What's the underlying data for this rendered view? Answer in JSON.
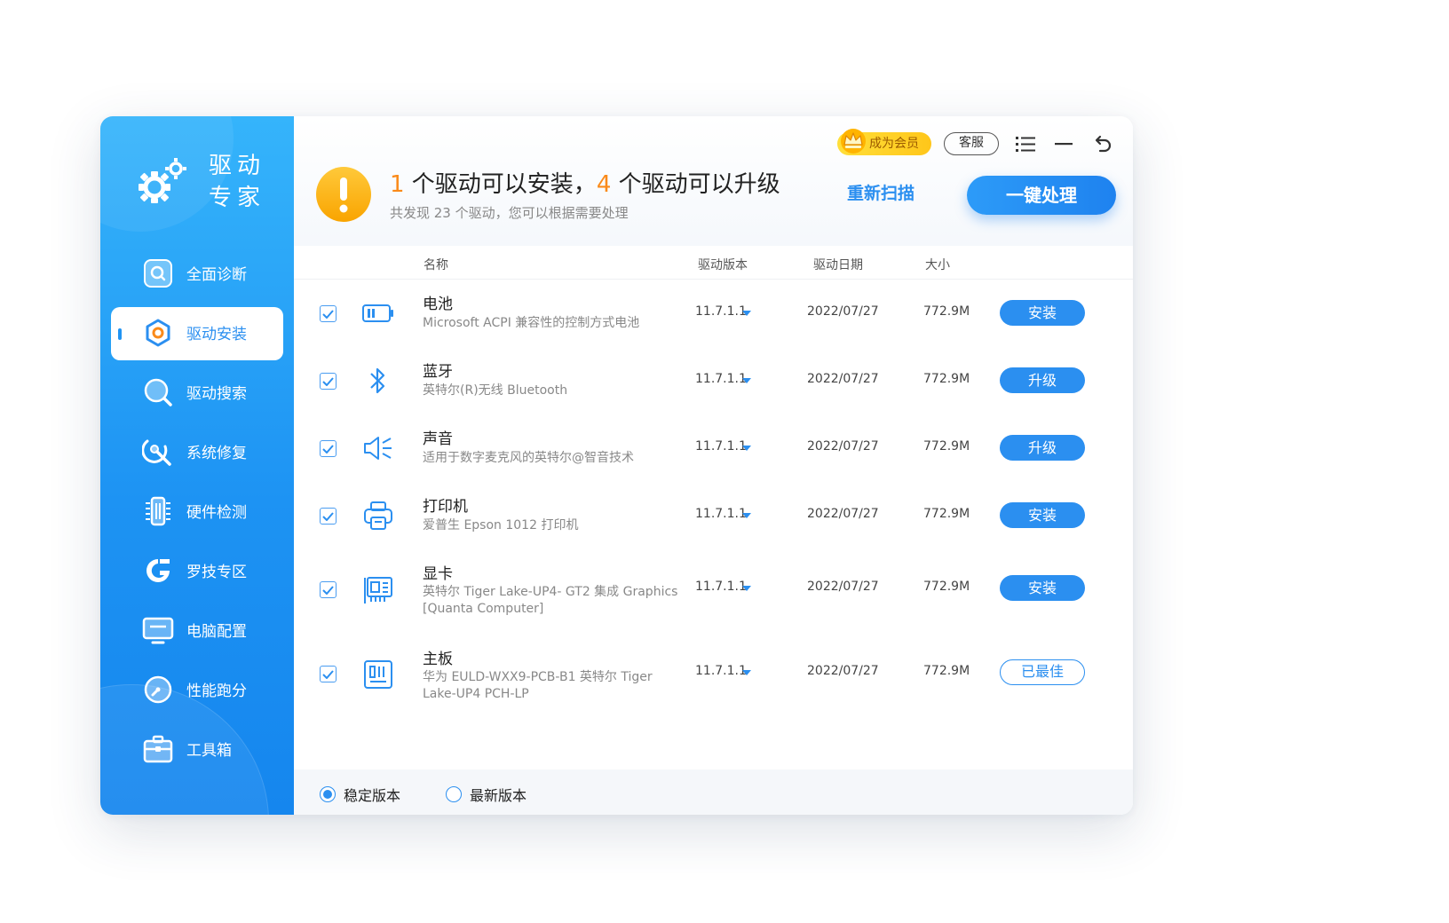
{
  "app": {
    "name_line1": "驱动",
    "name_line2": "专家"
  },
  "sidebar": {
    "items": [
      {
        "label": "全面诊断",
        "icon": "diagnose-icon"
      },
      {
        "label": "驱动安装",
        "icon": "install-icon",
        "active": true
      },
      {
        "label": "驱动搜索",
        "icon": "search-icon"
      },
      {
        "label": "系统修复",
        "icon": "repair-icon"
      },
      {
        "label": "硬件检测",
        "icon": "hardware-icon"
      },
      {
        "label": "罗技专区",
        "icon": "logitech-icon"
      },
      {
        "label": "电脑配置",
        "icon": "monitor-icon"
      },
      {
        "label": "性能跑分",
        "icon": "speedometer-icon"
      },
      {
        "label": "工具箱",
        "icon": "toolbox-icon"
      }
    ]
  },
  "topbar": {
    "vip_label": "成为会员",
    "service_label": "客服"
  },
  "summary": {
    "install_count": "1",
    "install_text": " 个驱动可以安装，",
    "upgrade_count": "4",
    "upgrade_text": " 个驱动可以升级",
    "subline": "共发现 23 个驱动，您可以根据需要处理",
    "rescan_label": "重新扫描",
    "onekey_label": "一键处理"
  },
  "table": {
    "headers": {
      "name": "名称",
      "version": "驱动版本",
      "date": "驱动日期",
      "size": "大小"
    },
    "rows": [
      {
        "name": "电池",
        "desc": "Microsoft ACPI 兼容性的控制方式电池",
        "version": "11.7.1.1",
        "date": "2022/07/27",
        "size": "772.9M",
        "action": "安装",
        "icon": "battery-icon",
        "checked": true
      },
      {
        "name": "蓝牙",
        "desc": "英特尔(R)无线 Bluetooth",
        "version": "11.7.1.1",
        "date": "2022/07/27",
        "size": "772.9M",
        "action": "升级",
        "icon": "bluetooth-icon",
        "checked": true
      },
      {
        "name": "声音",
        "desc": "适用于数字麦克风的英特尔@智音技术",
        "version": "11.7.1.1",
        "date": "2022/07/27",
        "size": "772.9M",
        "action": "升级",
        "icon": "speaker-icon",
        "checked": true
      },
      {
        "name": "打印机",
        "desc": "爱普生 Epson 1012 打印机",
        "version": "11.7.1.1",
        "date": "2022/07/27",
        "size": "772.9M",
        "action": "安装",
        "icon": "printer-icon",
        "checked": true
      },
      {
        "name": "显卡",
        "desc": "英特尔 Tiger Lake-UP4- GT2 集成 Graphics [Quanta Computer]",
        "version": "11.7.1.1",
        "date": "2022/07/27",
        "size": "772.9M",
        "action": "安装",
        "icon": "graphics-card-icon",
        "checked": true
      },
      {
        "name": "主板",
        "desc": "华为 EULD-WXX9-PCB-B1 英特尔 Tiger Lake-UP4 PCH-LP",
        "version": "11.7.1.1",
        "date": "2022/07/27",
        "size": "772.9M",
        "action": "已最佳",
        "icon": "motherboard-icon",
        "checked": true
      }
    ]
  },
  "footer": {
    "stable_label": "稳定版本",
    "latest_label": "最新版本",
    "selected": "stable"
  },
  "colors": {
    "accent": "#2b8ff0",
    "orange": "#fa8a1a",
    "sidebar_top": "#35b4fb",
    "sidebar_bottom": "#1586ee"
  }
}
